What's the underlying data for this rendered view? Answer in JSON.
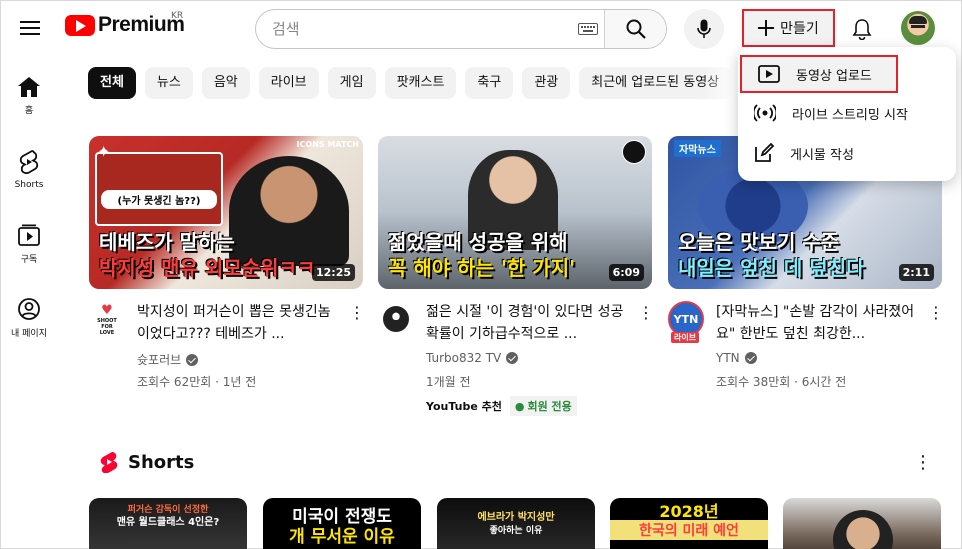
{
  "header": {
    "brand": "Premium",
    "region": "KR",
    "search_placeholder": "검색",
    "create_label": "만들기"
  },
  "sidebar": {
    "items": [
      {
        "label": "홈",
        "icon": "home-icon"
      },
      {
        "label": "Shorts",
        "icon": "shorts-icon"
      },
      {
        "label": "구독",
        "icon": "subscriptions-icon"
      },
      {
        "label": "내 페이지",
        "icon": "you-icon"
      }
    ]
  },
  "chips": [
    "전체",
    "뉴스",
    "음악",
    "라이브",
    "게임",
    "팟캐스트",
    "축구",
    "관광",
    "최근에 업로드된 동영상"
  ],
  "videos": [
    {
      "thumb_caption_1": "테베즈가 말하는",
      "thumb_caption_2": "박지성 맨유 외모순위ㅋㅋ",
      "thumb_inset": "(누가 못생긴 놈??)",
      "thumb_badge": "ICONS MATCH",
      "duration": "12:25",
      "title": "박지성이 퍼거슨이 뽑은 못생긴놈이었다고??? 테베즈가 ...",
      "channel": "슛포러브",
      "stats": "조회수 62만회 · 1년 전",
      "channel_avatar_text": "SHOOT FOR LOVE"
    },
    {
      "thumb_caption_1": "젊었을때 성공을 위해",
      "thumb_caption_2": "꼭 해야 하는 '한 가지'",
      "duration": "6:09",
      "title": "젊은 시절 '이 경험'이 있다면 성공 확률이 기하급수적으로 ...",
      "channel": "Turbo832 TV",
      "stats": "1개월 전",
      "tag_recommend": "YouTube 추천",
      "tag_members": "회원 전용"
    },
    {
      "thumb_caption_1": "오늘은 맛보기 수준",
      "thumb_caption_2": "내일은 엎친 데 덮친다",
      "thumb_badge": "자막뉴스",
      "duration": "2:11",
      "title": "[자막뉴스] \"손발 감각이 사라졌어요\" 한반도 덮친 최강한...",
      "channel": "YTN",
      "stats": "조회수 38만회 · 6시간 전",
      "channel_avatar_text": "YTN",
      "live_badge": "라이브"
    }
  ],
  "shorts": {
    "title": "Shorts",
    "items": [
      {
        "line1": "퍼거슨 감독이 선정한",
        "line2": "맨유 월드클래스 4인은?"
      },
      {
        "line1": "미국이 전쟁도",
        "line2": "개 무서운 이유"
      },
      {
        "line1": "에브라가 박지성만",
        "line2": "좋아하는 이유"
      },
      {
        "line1": "2028년",
        "line2": "한국의 미래 예언"
      },
      {
        "line1": "",
        "line2": ""
      }
    ]
  },
  "create_menu": {
    "items": [
      {
        "label": "동영상 업로드",
        "icon": "upload-video-icon"
      },
      {
        "label": "라이브 스트리밍 시작",
        "icon": "live-stream-icon"
      },
      {
        "label": "게시물 작성",
        "icon": "edit-post-icon"
      }
    ]
  },
  "colors": {
    "brand_red": "#ff0000",
    "highlight_red": "#e8202a"
  }
}
